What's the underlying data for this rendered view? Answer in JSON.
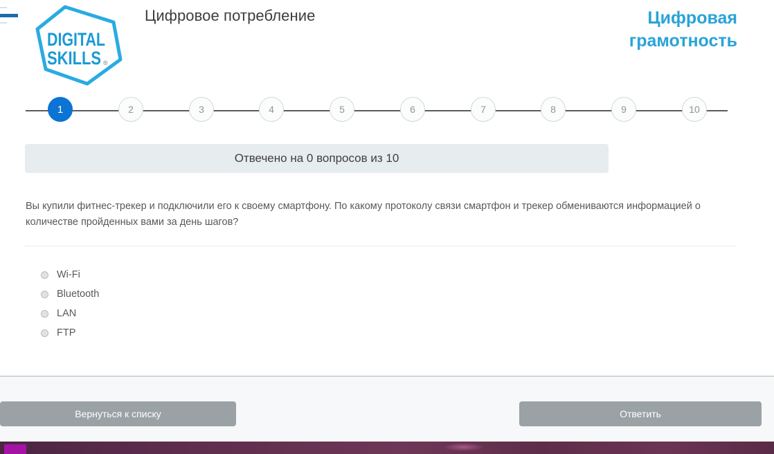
{
  "header": {
    "logo_line1": "DIGITAL",
    "logo_line2": "SKILLS",
    "logo_mark": "®",
    "page_title": "Цифровое потребление",
    "brand_title": "Цифровая\nграмотность",
    "brand_color": "#29a3d8",
    "logo_color": "#29abe2"
  },
  "stepper": {
    "active_step": 1,
    "active_color": "#0b74d4",
    "steps": [
      {
        "label": "1"
      },
      {
        "label": "2"
      },
      {
        "label": "3"
      },
      {
        "label": "4"
      },
      {
        "label": "5"
      },
      {
        "label": "6"
      },
      {
        "label": "7"
      },
      {
        "label": "8"
      },
      {
        "label": "9"
      },
      {
        "label": "10"
      }
    ]
  },
  "progress": {
    "text": "Отвечено на 0 вопросов из 10",
    "answered": 0,
    "total": 10
  },
  "question": {
    "text": "Вы купили фитнес-трекер и подключили его к своему смартфону. По какому протоколу связи смартфон и трекер обмениваются информацией о количестве пройденных вами за день шагов?",
    "options": [
      {
        "label": "Wi-Fi",
        "selected": false
      },
      {
        "label": "Bluetooth",
        "selected": false
      },
      {
        "label": "LAN",
        "selected": false
      },
      {
        "label": "FTP",
        "selected": false
      }
    ]
  },
  "footer": {
    "back_label": "Вернуться к списку",
    "submit_label": "Ответить",
    "button_color": "#9aa2a6"
  }
}
